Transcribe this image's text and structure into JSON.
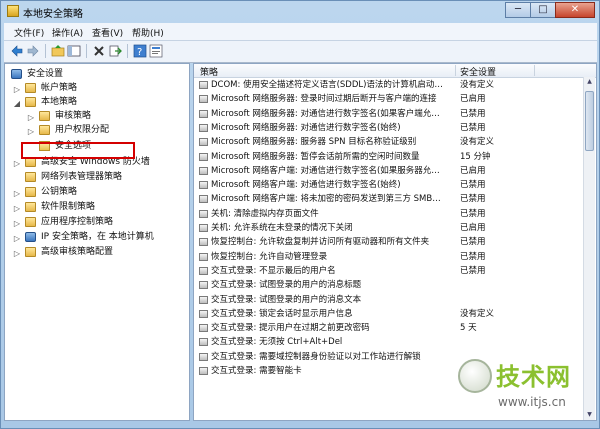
{
  "window": {
    "title": "本地安全策略",
    "min": "─",
    "max": "□",
    "close": "✕"
  },
  "menu": [
    "文件(F)",
    "操作(A)",
    "查看(V)",
    "帮助(H)"
  ],
  "tree": [
    {
      "label": "安全设置",
      "arrow": "",
      "icon": "shield-icon"
    },
    {
      "label": "帐户策略",
      "arrow": "▷",
      "icon": "folder-icon"
    },
    {
      "label": "本地策略",
      "arrow": "◢",
      "icon": "folder-icon"
    },
    {
      "label": "审核策略",
      "arrow": "▷",
      "icon": "folder-icon"
    },
    {
      "label": "用户权限分配",
      "arrow": "▷",
      "icon": "folder-icon"
    },
    {
      "label": "安全选项",
      "arrow": "",
      "icon": "folder-icon"
    },
    {
      "label": "高级安全 Windows 防火墙",
      "arrow": "▷",
      "icon": "firewall-icon"
    },
    {
      "label": "网络列表管理器策略",
      "arrow": "",
      "icon": "folder-icon"
    },
    {
      "label": "公钥策略",
      "arrow": "▷",
      "icon": "folder-icon"
    },
    {
      "label": "软件限制策略",
      "arrow": "▷",
      "icon": "folder-icon"
    },
    {
      "label": "应用程序控制策略",
      "arrow": "▷",
      "icon": "folder-icon"
    },
    {
      "label": "IP 安全策略，在 本地计算机",
      "arrow": "▷",
      "icon": "ip-security-icon"
    },
    {
      "label": "高级审核策略配置",
      "arrow": "▷",
      "icon": "folder-icon"
    }
  ],
  "list": {
    "col_policy": "策略",
    "col_setting": "安全设置",
    "rows": [
      {
        "policy": "DCOM: 使用安全描述符定义语言(SDDL)语法的计算机启动…",
        "setting": "没有定义"
      },
      {
        "policy": "Microsoft 网络服务器: 登录时间过期后断开与客户端的连接",
        "setting": "已启用"
      },
      {
        "policy": "Microsoft 网络服务器: 对通信进行数字签名(如果客户端允…",
        "setting": "已禁用"
      },
      {
        "policy": "Microsoft 网络服务器: 对通信进行数字签名(始终)",
        "setting": "已禁用"
      },
      {
        "policy": "Microsoft 网络服务器: 服务器 SPN 目标名称验证级别",
        "setting": "没有定义"
      },
      {
        "policy": "Microsoft 网络服务器: 暂停会话前所需的空闲时间数量",
        "setting": "15 分钟"
      },
      {
        "policy": "Microsoft 网络客户端: 对通信进行数字签名(如果服务器允…",
        "setting": "已启用"
      },
      {
        "policy": "Microsoft 网络客户端: 对通信进行数字签名(始终)",
        "setting": "已禁用"
      },
      {
        "policy": "Microsoft 网络客户端: 将未加密的密码发送到第三方 SMB…",
        "setting": "已禁用"
      },
      {
        "policy": "关机: 清除虚拟内存页面文件",
        "setting": "已禁用"
      },
      {
        "policy": "关机: 允许系统在未登录的情况下关闭",
        "setting": "已启用"
      },
      {
        "policy": "恢复控制台: 允许软盘复制并访问所有驱动器和所有文件夹",
        "setting": "已禁用"
      },
      {
        "policy": "恢复控制台: 允许自动管理登录",
        "setting": "已禁用"
      },
      {
        "policy": "交互式登录: 不显示最后的用户名",
        "setting": "已禁用"
      },
      {
        "policy": "交互式登录: 试图登录的用户的消息标题",
        "setting": ""
      },
      {
        "policy": "交互式登录: 试图登录的用户的消息文本",
        "setting": ""
      },
      {
        "policy": "交互式登录: 锁定会话时显示用户信息",
        "setting": "没有定义"
      },
      {
        "policy": "交互式登录: 提示用户在过期之前更改密码",
        "setting": "5 天"
      },
      {
        "policy": "交互式登录: 无须按 Ctrl+Alt+Del",
        "setting": ""
      },
      {
        "policy": "交互式登录: 需要域控制器身份验证以对工作站进行解锁",
        "setting": ""
      },
      {
        "policy": "交互式登录: 需要智能卡",
        "setting": ""
      }
    ]
  },
  "watermark": {
    "brand": "技术网",
    "url": "www.itjs.cn"
  },
  "colors": {
    "highlight_box": "#d40000",
    "watermark_green": "#8bc02f"
  }
}
